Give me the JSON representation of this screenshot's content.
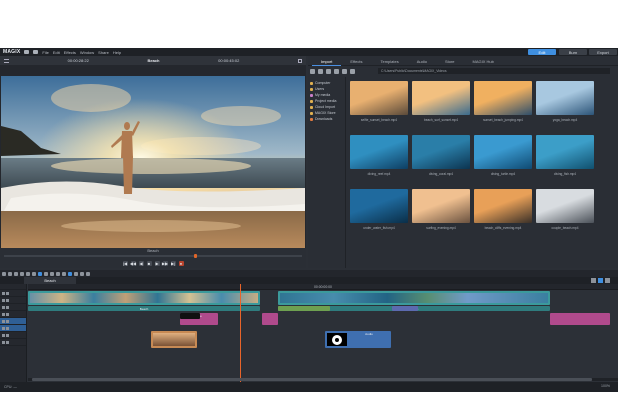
{
  "app": {
    "brand": "MAGIX",
    "menu": [
      "File",
      "Edit",
      "Effects",
      "Window",
      "Share",
      "Help"
    ],
    "modes": [
      {
        "label": "Edit",
        "active": true
      },
      {
        "label": "Burn",
        "active": false
      },
      {
        "label": "Export",
        "active": false
      }
    ]
  },
  "preview": {
    "timecode_left": "00:00:28:22",
    "title": "Beach",
    "timecode_right": "00:00:45:02",
    "label": "Beach",
    "controls": [
      "|◀",
      "◀◀",
      "◀",
      "■",
      "▶",
      "▶▶",
      "▶|",
      "●"
    ]
  },
  "media_pool": {
    "tabs": [
      "Import",
      "Effects",
      "Templates",
      "Audio",
      "Store",
      "MAGIX Hub"
    ],
    "active_tab": "Import",
    "path": "C:\\Users\\Public\\Documents\\MAGIX_Videos",
    "sidebar": [
      {
        "label": "Computer",
        "color": "#e0b050"
      },
      {
        "label": "Users",
        "color": "#e0b050"
      },
      {
        "label": "My media",
        "color": "#c97ec9"
      },
      {
        "label": "Project media",
        "color": "#e0b050"
      },
      {
        "label": "Cloud Import",
        "color": "#e0b050"
      },
      {
        "label": "MAGIX Store",
        "color": "#e0b050"
      },
      {
        "label": "Downloads",
        "color": "#e07a40"
      }
    ],
    "items": [
      {
        "name": "selfie_sunset_beach.mp4",
        "c1": "#e8b070",
        "c2": "#5a4a3a"
      },
      {
        "name": "beach_surf_sunset.mp4",
        "c1": "#f2c080",
        "c2": "#3a6b8e"
      },
      {
        "name": "sunset_beach_jumping.mp4",
        "c1": "#f0b060",
        "c2": "#2e4e6a"
      },
      {
        "name": "yoga_beach.mp4",
        "c1": "#a8c8e0",
        "c2": "#2c5478"
      },
      {
        "name": "diving_reef.mp4",
        "c1": "#2f8fc0",
        "c2": "#0e3e62"
      },
      {
        "name": "diving_coral.mp4",
        "c1": "#2a7ea8",
        "c2": "#0c3450"
      },
      {
        "name": "diving_turtle.mp4",
        "c1": "#3a9ad0",
        "c2": "#0f4a72"
      },
      {
        "name": "diving_fish.mp4",
        "c1": "#3c9ec8",
        "c2": "#10506e"
      },
      {
        "name": "under_water_fish.mp4",
        "c1": "#1f6a9e",
        "c2": "#0a2e48"
      },
      {
        "name": "surfing_evening.mp4",
        "c1": "#f0c090",
        "c2": "#6a5240"
      },
      {
        "name": "beach_cliffs_evening.mp4",
        "c1": "#e8a058",
        "c2": "#3a3028"
      },
      {
        "name": "couple_beach.mp4",
        "c1": "#d8dce0",
        "c2": "#4a5058"
      }
    ]
  },
  "timeline": {
    "tab": "Beach",
    "ruler_label": "00:00:00:00",
    "clips": [
      {
        "label": "Beach",
        "track": 1,
        "color": "#3f9ea0"
      },
      {
        "label": "Beach",
        "track": 2,
        "color": "#3f9ea0"
      },
      {
        "label": "Title",
        "track": 3,
        "color": "#c04f9e"
      },
      {
        "label": "Audio",
        "track": 5,
        "color": "#3f6fb0"
      }
    ],
    "zoom": "100%"
  },
  "status": {
    "text": "CPU: —"
  }
}
